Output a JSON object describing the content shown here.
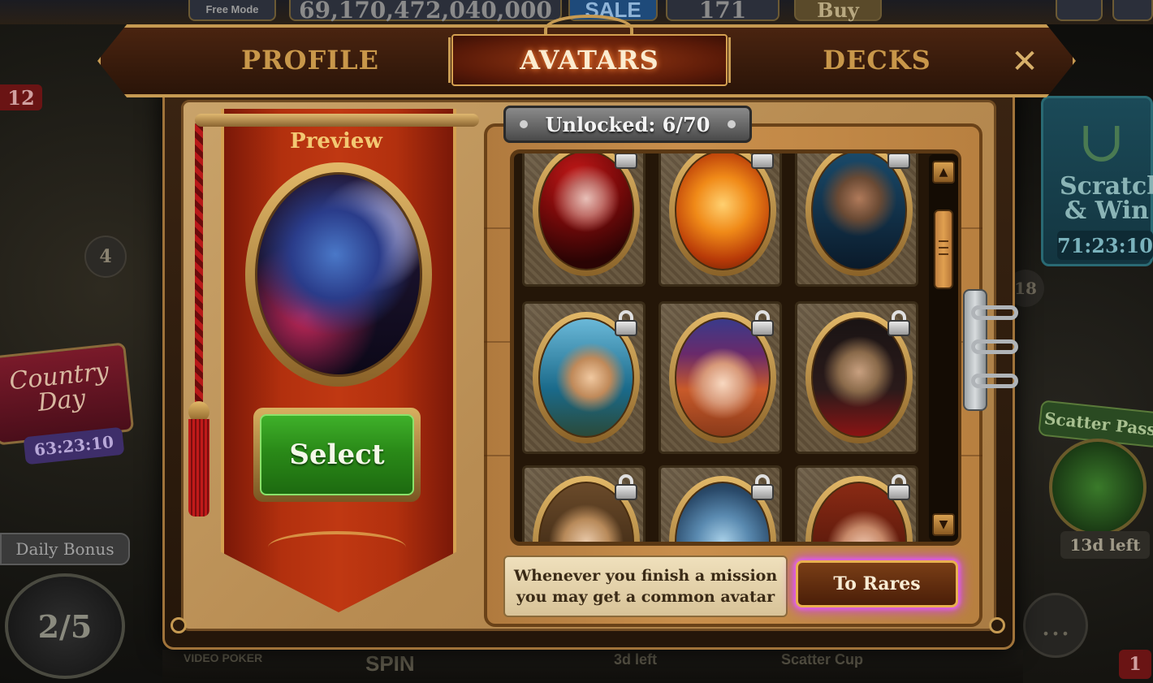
{
  "background": {
    "free_mode": "Free Mode",
    "coins": "69,170,472,040,000",
    "sale": "SALE",
    "gems": "171",
    "buy": "Buy",
    "level_badge": "12",
    "map_node_4": "4",
    "map_node_18": "18",
    "country_day": "Country Day",
    "country_day_timer": "63:23:10",
    "daily_bonus": "Daily Bonus",
    "daily_bonus_progress": "2/5",
    "scratch_win": "Scratch & Win",
    "scratch_timer": "71:23:10",
    "scatter_pass": "Scatter Pass",
    "scatter_pass_left": "13d left",
    "video_poker": "VIDEO POKER",
    "spin": "SPIN",
    "three_d_left": "3d left",
    "scatter_cup": "Scatter Cup",
    "notification_badge": "1"
  },
  "tabs": {
    "profile": "PROFILE",
    "avatars": "AVATARS",
    "decks": "DECKS",
    "active": "avatars"
  },
  "close_icon": "close-x",
  "preview": {
    "title": "Preview",
    "select_label": "Select"
  },
  "collection": {
    "unlocked_label": "Unlocked: 6/70",
    "unlocked_count": 6,
    "total_count": 70,
    "avatars": [
      {
        "id": "masked-red-hair",
        "locked": true
      },
      {
        "id": "flame-pumpkin",
        "locked": true
      },
      {
        "id": "bearded-warrior",
        "locked": true
      },
      {
        "id": "pirate-lady",
        "locked": true
      },
      {
        "id": "witch-hat-girl",
        "locked": true
      },
      {
        "id": "tattooed-man",
        "locked": true
      },
      {
        "id": "blonde-woman",
        "locked": true
      },
      {
        "id": "blue-creature",
        "locked": true
      },
      {
        "id": "red-haired-woman",
        "locked": true
      }
    ],
    "hint_line1": "Whenever you finish a mission",
    "hint_line2": "you may get a common avatar",
    "to_rares_label": "To Rares"
  },
  "colors": {
    "accent_gold": "#c69a52",
    "banner_red": "#b2300e",
    "select_green": "#2a8a18",
    "rares_glow": "#d048e0"
  }
}
